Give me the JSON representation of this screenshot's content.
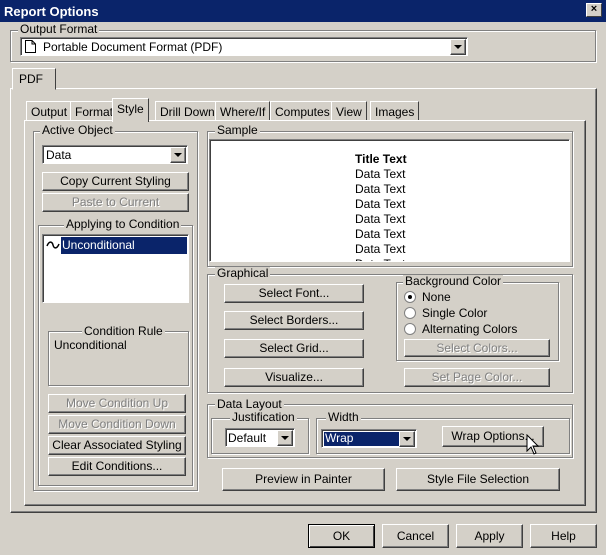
{
  "window": {
    "title": "Report Options",
    "close_label": "×"
  },
  "output_format": {
    "label": "Output Format",
    "value": "Portable Document Format (PDF)"
  },
  "outer_tab": {
    "label": "PDF"
  },
  "tabs": [
    "Output",
    "Format",
    "Style",
    "Drill Down",
    "Where/If",
    "Computes",
    "View",
    "Images"
  ],
  "active_tab": "Style",
  "active_object": {
    "label": "Active Object",
    "value": "Data",
    "copy_label": "Copy Current Styling",
    "paste_label": "Paste to Current"
  },
  "conditions": {
    "label": "Applying to Condition",
    "items": [
      "Unconditional"
    ],
    "rule_label": "Condition Rule",
    "rule_value": "Unconditional",
    "move_up": "Move Condition Up",
    "move_down": "Move Condition Down",
    "clear": "Clear Associated Styling",
    "edit": "Edit Conditions..."
  },
  "sample": {
    "label": "Sample",
    "title_text": "Title Text",
    "data_text": "Data Text"
  },
  "graphical": {
    "label": "Graphical",
    "select_font": "Select Font...",
    "select_borders": "Select Borders...",
    "select_grid": "Select Grid...",
    "visualize": "Visualize..."
  },
  "background_color": {
    "label": "Background Color",
    "options": [
      "None",
      "Single Color",
      "Alternating Colors"
    ],
    "selected": "None",
    "select_colors": "Select Colors...",
    "set_page_color": "Set Page Color..."
  },
  "data_layout": {
    "label": "Data Layout",
    "justification_label": "Justification",
    "justification_value": "Default",
    "width_label": "Width",
    "width_value": "Wrap",
    "wrap_options": "Wrap Options..."
  },
  "actions": {
    "preview": "Preview in Painter",
    "style_file": "Style File Selection"
  },
  "footer": {
    "ok": "OK",
    "cancel": "Cancel",
    "apply": "Apply",
    "help": "Help"
  }
}
